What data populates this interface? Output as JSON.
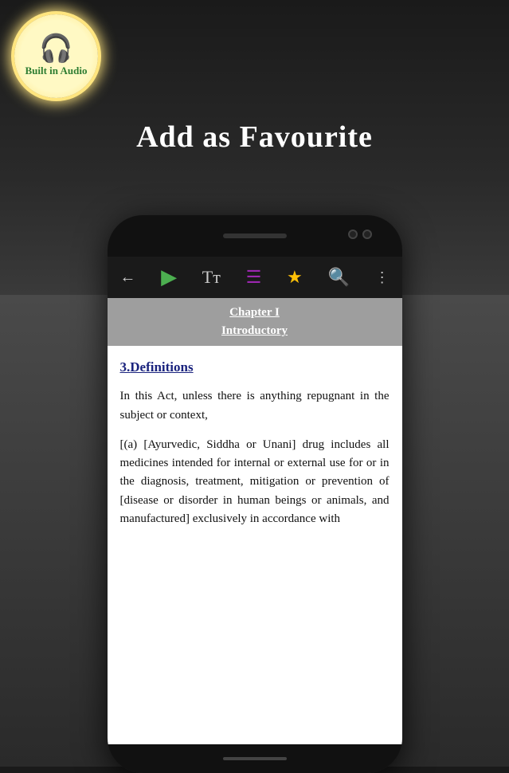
{
  "background": {
    "top_color": "#1a1a1a",
    "bottom_color": "#2a2a2a"
  },
  "audio_badge": {
    "text": "Built in Audio",
    "icon": "🎧"
  },
  "page_title": "Add as Favourite",
  "phone": {
    "toolbar": {
      "back_icon": "←",
      "play_icon": "▶",
      "text_icon": "Tт",
      "list_icon": "☰",
      "star_icon": "★",
      "search_icon": "🔍",
      "more_icon": "⋮"
    },
    "chapter_header": {
      "title": "Chapter I",
      "subtitle": "Introductory"
    },
    "content": {
      "section_number": "3.",
      "section_title": "Definitions",
      "paragraph1": "In this Act, unless there is anything repugnant in the subject or context,",
      "paragraph2": "[(a)  [Ayurvedic, Siddha or Unani] drug includes all medicines intended for internal or external use for or in the diagnosis, treatment, mitigation or prevention of [disease or disorder in human beings or animals, and manufactured] exclusively in accordance with"
    }
  }
}
